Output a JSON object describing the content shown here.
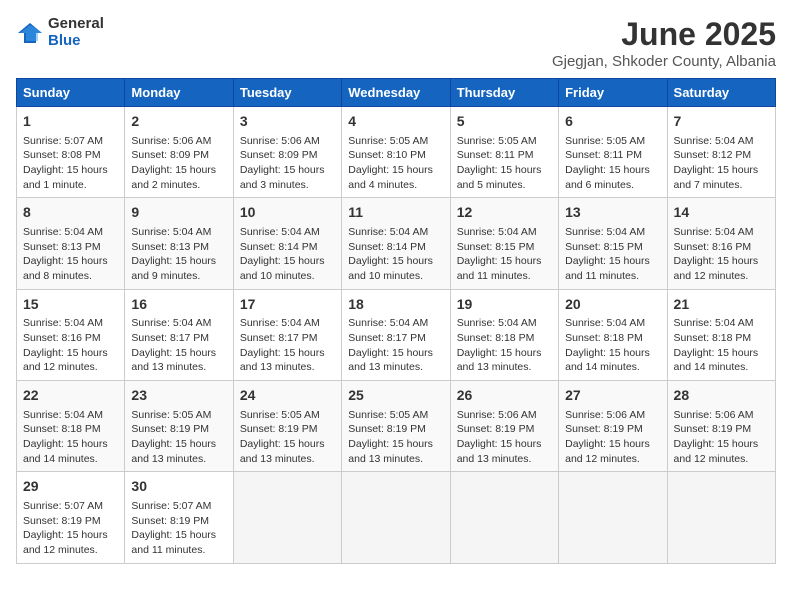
{
  "logo": {
    "general": "General",
    "blue": "Blue"
  },
  "title": "June 2025",
  "subtitle": "Gjegjan, Shkoder County, Albania",
  "days": [
    "Sunday",
    "Monday",
    "Tuesday",
    "Wednesday",
    "Thursday",
    "Friday",
    "Saturday"
  ],
  "weeks": [
    [
      {
        "day": 1,
        "sunrise": "5:07 AM",
        "sunset": "8:08 PM",
        "daylight": "15 hours and 1 minute."
      },
      {
        "day": 2,
        "sunrise": "5:06 AM",
        "sunset": "8:09 PM",
        "daylight": "15 hours and 2 minutes."
      },
      {
        "day": 3,
        "sunrise": "5:06 AM",
        "sunset": "8:09 PM",
        "daylight": "15 hours and 3 minutes."
      },
      {
        "day": 4,
        "sunrise": "5:05 AM",
        "sunset": "8:10 PM",
        "daylight": "15 hours and 4 minutes."
      },
      {
        "day": 5,
        "sunrise": "5:05 AM",
        "sunset": "8:11 PM",
        "daylight": "15 hours and 5 minutes."
      },
      {
        "day": 6,
        "sunrise": "5:05 AM",
        "sunset": "8:11 PM",
        "daylight": "15 hours and 6 minutes."
      },
      {
        "day": 7,
        "sunrise": "5:04 AM",
        "sunset": "8:12 PM",
        "daylight": "15 hours and 7 minutes."
      }
    ],
    [
      {
        "day": 8,
        "sunrise": "5:04 AM",
        "sunset": "8:13 PM",
        "daylight": "15 hours and 8 minutes."
      },
      {
        "day": 9,
        "sunrise": "5:04 AM",
        "sunset": "8:13 PM",
        "daylight": "15 hours and 9 minutes."
      },
      {
        "day": 10,
        "sunrise": "5:04 AM",
        "sunset": "8:14 PM",
        "daylight": "15 hours and 10 minutes."
      },
      {
        "day": 11,
        "sunrise": "5:04 AM",
        "sunset": "8:14 PM",
        "daylight": "15 hours and 10 minutes."
      },
      {
        "day": 12,
        "sunrise": "5:04 AM",
        "sunset": "8:15 PM",
        "daylight": "15 hours and 11 minutes."
      },
      {
        "day": 13,
        "sunrise": "5:04 AM",
        "sunset": "8:15 PM",
        "daylight": "15 hours and 11 minutes."
      },
      {
        "day": 14,
        "sunrise": "5:04 AM",
        "sunset": "8:16 PM",
        "daylight": "15 hours and 12 minutes."
      }
    ],
    [
      {
        "day": 15,
        "sunrise": "5:04 AM",
        "sunset": "8:16 PM",
        "daylight": "15 hours and 12 minutes."
      },
      {
        "day": 16,
        "sunrise": "5:04 AM",
        "sunset": "8:17 PM",
        "daylight": "15 hours and 13 minutes."
      },
      {
        "day": 17,
        "sunrise": "5:04 AM",
        "sunset": "8:17 PM",
        "daylight": "15 hours and 13 minutes."
      },
      {
        "day": 18,
        "sunrise": "5:04 AM",
        "sunset": "8:17 PM",
        "daylight": "15 hours and 13 minutes."
      },
      {
        "day": 19,
        "sunrise": "5:04 AM",
        "sunset": "8:18 PM",
        "daylight": "15 hours and 13 minutes."
      },
      {
        "day": 20,
        "sunrise": "5:04 AM",
        "sunset": "8:18 PM",
        "daylight": "15 hours and 14 minutes."
      },
      {
        "day": 21,
        "sunrise": "5:04 AM",
        "sunset": "8:18 PM",
        "daylight": "15 hours and 14 minutes."
      }
    ],
    [
      {
        "day": 22,
        "sunrise": "5:04 AM",
        "sunset": "8:18 PM",
        "daylight": "15 hours and 14 minutes."
      },
      {
        "day": 23,
        "sunrise": "5:05 AM",
        "sunset": "8:19 PM",
        "daylight": "15 hours and 13 minutes."
      },
      {
        "day": 24,
        "sunrise": "5:05 AM",
        "sunset": "8:19 PM",
        "daylight": "15 hours and 13 minutes."
      },
      {
        "day": 25,
        "sunrise": "5:05 AM",
        "sunset": "8:19 PM",
        "daylight": "15 hours and 13 minutes."
      },
      {
        "day": 26,
        "sunrise": "5:06 AM",
        "sunset": "8:19 PM",
        "daylight": "15 hours and 13 minutes."
      },
      {
        "day": 27,
        "sunrise": "5:06 AM",
        "sunset": "8:19 PM",
        "daylight": "15 hours and 12 minutes."
      },
      {
        "day": 28,
        "sunrise": "5:06 AM",
        "sunset": "8:19 PM",
        "daylight": "15 hours and 12 minutes."
      }
    ],
    [
      {
        "day": 29,
        "sunrise": "5:07 AM",
        "sunset": "8:19 PM",
        "daylight": "15 hours and 12 minutes."
      },
      {
        "day": 30,
        "sunrise": "5:07 AM",
        "sunset": "8:19 PM",
        "daylight": "15 hours and 11 minutes."
      },
      null,
      null,
      null,
      null,
      null
    ]
  ],
  "labels": {
    "sunrise": "Sunrise:",
    "sunset": "Sunset:",
    "daylight": "Daylight:"
  }
}
